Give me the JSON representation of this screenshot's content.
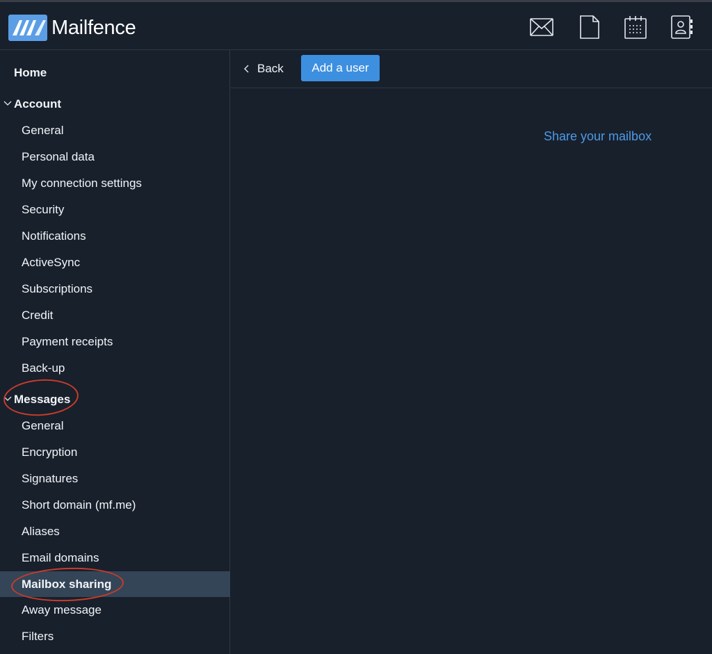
{
  "app": {
    "brand": "Mailfence"
  },
  "topbar": {
    "icons": [
      "mail-icon",
      "document-icon",
      "calendar-icon",
      "contacts-icon"
    ]
  },
  "sidebar": {
    "home": "Home",
    "account": {
      "label": "Account",
      "items": [
        "General",
        "Personal data",
        "My connection settings",
        "Security",
        "Notifications",
        "ActiveSync",
        "Subscriptions",
        "Credit",
        "Payment receipts",
        "Back-up"
      ]
    },
    "messages": {
      "label": "Messages",
      "items": [
        "General",
        "Encryption",
        "Signatures",
        "Short domain (mf.me)",
        "Aliases",
        "Email domains",
        "Mailbox sharing",
        "Away message",
        "Filters"
      ],
      "active": "Mailbox sharing"
    }
  },
  "toolbar": {
    "back_label": "Back",
    "add_label": "Add a user"
  },
  "main": {
    "share_link": "Share your mailbox"
  },
  "colors": {
    "background": "#18202c",
    "active_item": "#344558",
    "button": "#3d8fe0",
    "link": "#4c9ae6",
    "annotation": "#c93c2a"
  }
}
